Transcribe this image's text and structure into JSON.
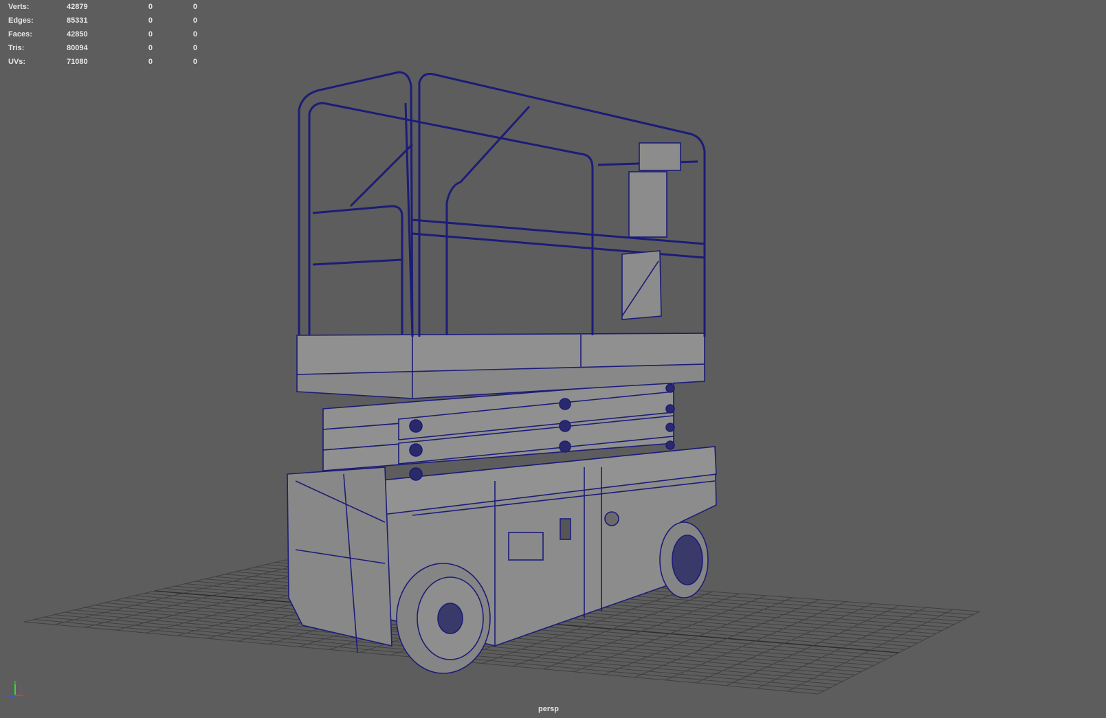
{
  "hud": {
    "rows": [
      {
        "label": "Verts:",
        "value": "42879",
        "sel": "0",
        "comp": "0"
      },
      {
        "label": "Edges:",
        "value": "85331",
        "sel": "0",
        "comp": "0"
      },
      {
        "label": "Faces:",
        "value": "42850",
        "sel": "0",
        "comp": "0"
      },
      {
        "label": "Tris:",
        "value": "80094",
        "sel": "0",
        "comp": "0"
      },
      {
        "label": "UVs:",
        "value": "71080",
        "sel": "0",
        "comp": "0"
      }
    ]
  },
  "camera": {
    "label": "persp"
  },
  "axis": {
    "x": "x",
    "y": "y",
    "z": "z"
  },
  "colors": {
    "background": "#5d5d5d",
    "wire": "#1c1c78",
    "mesh": "#8c8c8c",
    "grid": "#3e3e3e"
  }
}
